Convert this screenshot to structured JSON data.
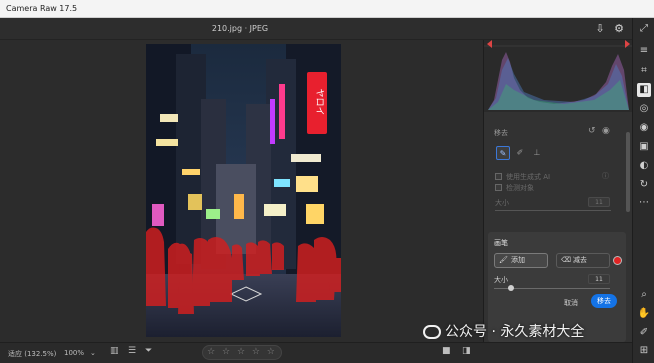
{
  "app": {
    "title": "Camera Raw 17.5"
  },
  "file": {
    "name": "210.jpg  ·  JPEG"
  },
  "bottom_bar": {
    "fit_label": "适应 (132.5%)",
    "zoom_label": "100%",
    "rating_stars": "☆ ☆ ☆ ☆ ☆"
  },
  "remove_panel": {
    "title": "移去",
    "generative_ai_label": "使用生成式 AI",
    "detect_objects_label": "检测对象",
    "size_label": "大小",
    "size_value": "11"
  },
  "brush_card": {
    "title": "画笔",
    "add_label": "添加",
    "subtract_label": "减去",
    "size_label": "大小",
    "size_value": "11",
    "cancel_label": "取消",
    "remove_label": "移去",
    "overlay_color": "#e02424"
  },
  "photo_sign": {
    "text": "ヤロイ"
  },
  "watermark": {
    "text": "公众号 · 永久素材大全"
  },
  "colors": {
    "accent": "#1473e6",
    "mask": "#d41f1f"
  }
}
